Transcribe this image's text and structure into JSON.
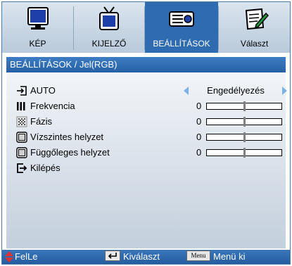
{
  "tabs": [
    {
      "label": "KÉP",
      "icon": "monitor-icon",
      "active": false
    },
    {
      "label": "KIJELZŐ",
      "icon": "tv-icon",
      "active": false
    },
    {
      "label": "BEÁLLÍTÁSOK",
      "icon": "projector-icon",
      "active": true
    },
    {
      "label": "Választ",
      "icon": "notepad-icon",
      "active": false
    }
  ],
  "header": {
    "title": "BEÁLLÍTÁSOK / Jel(RGB)"
  },
  "items": [
    {
      "label": "AUTO",
      "icon": "input-arrow-icon",
      "value": "Engedélyezés"
    },
    {
      "label": "Frekvencia",
      "icon": "frequency-bars-icon",
      "value": "0",
      "level": 0.5
    },
    {
      "label": "Fázis",
      "icon": "phase-pattern-icon",
      "value": "0",
      "level": 0.5
    },
    {
      "label": "Vízszintes helyzet",
      "icon": "h-position-icon",
      "value": "0",
      "level": 0.5
    },
    {
      "label": "Függőleges helyzet",
      "icon": "v-position-icon",
      "value": "0",
      "level": 0.5
    },
    {
      "label": "Kilépés",
      "icon": "exit-icon"
    }
  ],
  "footer": {
    "move_label": "FelLe",
    "select_label": "Kiválaszt",
    "menu_key": "Menu",
    "menu_label": "Menü ki"
  },
  "colors": {
    "accent": "#2f6bb0",
    "header": "#2661a6",
    "arrow": "#7ab3ea",
    "footer_arrow": "#e03030"
  }
}
